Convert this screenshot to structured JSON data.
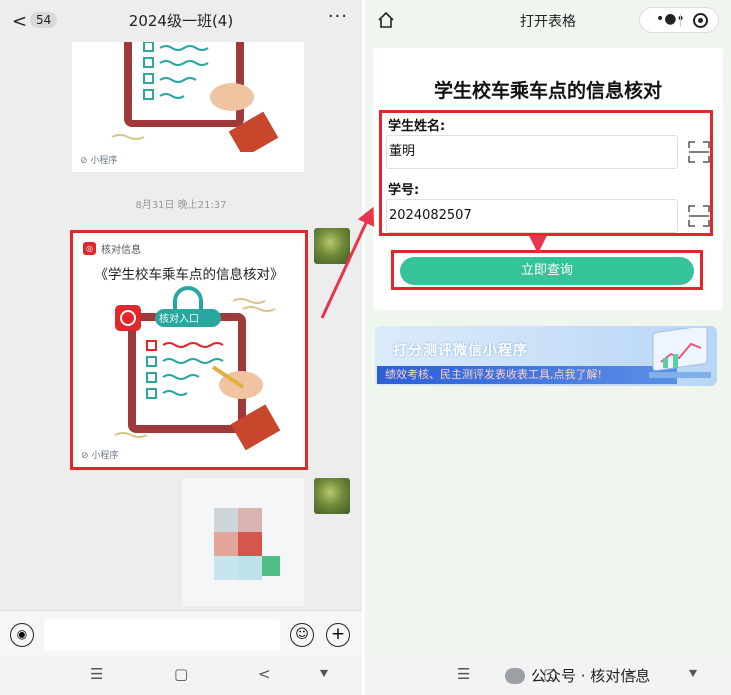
{
  "left_phone": {
    "header": {
      "back_glyph": "<",
      "unread_count": "54",
      "title": "2024级一班(4)",
      "more_glyph": "···"
    },
    "card1": {
      "mini_program_tag": "小程序"
    },
    "timestamp": "8月31日 晚上21:37",
    "card2": {
      "source": "核对信息",
      "title": "《学生校车乘车点的信息核对》",
      "illustration_tag": "核对入口",
      "mini_program_tag": "小程序"
    },
    "input_bar": {
      "voice_icon": "voice-icon",
      "emoji_icon": "emoji-icon",
      "plus_icon": "plus-icon"
    },
    "nav": {
      "menu": "☰",
      "home": "▢",
      "back": "<",
      "down": "⯆"
    }
  },
  "right_phone": {
    "header": {
      "title": "打开表格",
      "home_icon": "home-icon"
    },
    "form": {
      "title": "学生校车乘车点的信息核对",
      "name_label": "学生姓名:",
      "name_value": "董明",
      "id_label": "学号:",
      "id_value": "2024082507",
      "query_button": "立即查询"
    },
    "banner": {
      "title": "打分测评微信小程序",
      "subtitle": "绩效考核、民主测评发表收表工具,点我了解!"
    },
    "nav": {
      "menu": "☰",
      "home": "▢",
      "back": "<",
      "down": "⯆"
    },
    "watermark": "公众号 · 核对信息"
  },
  "colors": {
    "highlight": "#e0272c",
    "button": "#35c39a",
    "arrow": "#e8354b"
  }
}
